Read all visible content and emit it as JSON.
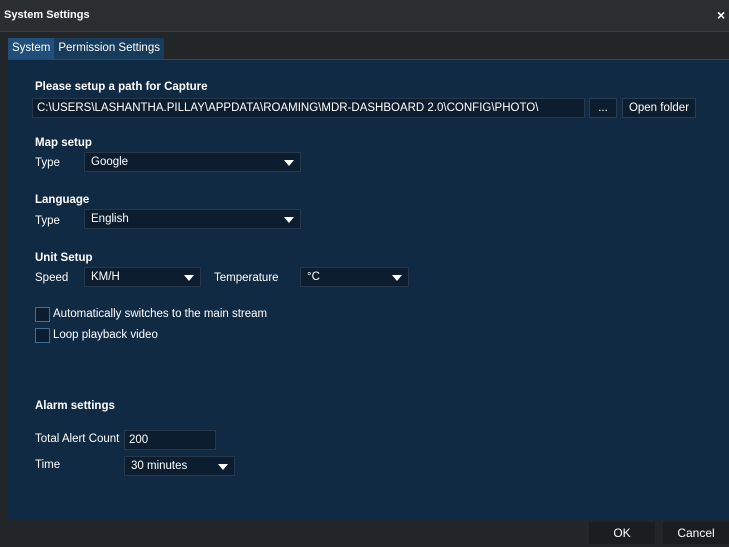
{
  "window": {
    "title": "System Settings",
    "close_glyph": "×"
  },
  "tabs": [
    {
      "label": "System",
      "active": true
    },
    {
      "label": "Permission Settings",
      "active": false
    }
  ],
  "capture": {
    "heading": "Please setup a path for Capture",
    "path_value": "C:\\USERS\\LASHANTHA.PILLAY\\APPDATA\\ROAMING\\MDR-DASHBOARD 2.0\\CONFIG\\PHOTO\\",
    "browse_label": "...",
    "open_folder_label": "Open folder"
  },
  "map_setup": {
    "heading": "Map setup",
    "type_label": "Type",
    "type_value": "Google"
  },
  "language": {
    "heading": "Language",
    "type_label": "Type",
    "type_value": "English"
  },
  "unit_setup": {
    "heading": "Unit Setup",
    "speed_label": "Speed",
    "speed_value": "KM/H",
    "temperature_label": "Temperature",
    "temperature_value": "°C"
  },
  "options": [
    {
      "label": "Automatically switches to the main stream",
      "checked": false
    },
    {
      "label": "Loop playback video",
      "checked": false
    }
  ],
  "alarm": {
    "heading": "Alarm settings",
    "total_label": "Total Alert Count",
    "total_value": "200",
    "time_label": "Time",
    "time_value": "30 minutes"
  },
  "footer": {
    "ok_label": "OK",
    "cancel_label": "Cancel"
  },
  "icons": {
    "dropdown": "chevron-down-icon",
    "close": "close-icon"
  },
  "colors": {
    "panel_bg": "#112a44",
    "tab_active": "#1f4f7a",
    "field_bg": "#0b1d2f",
    "window_bg": "#232629"
  }
}
